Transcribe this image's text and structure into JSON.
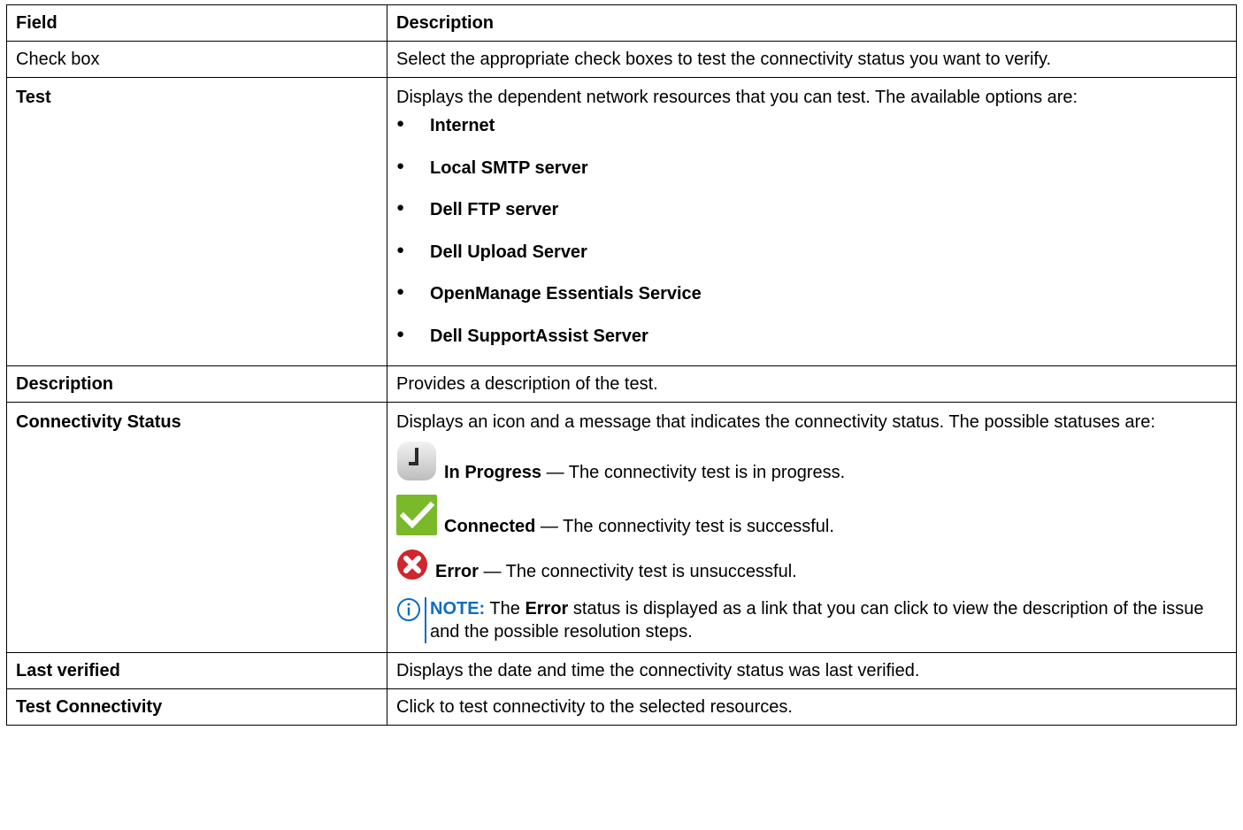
{
  "header": {
    "col1": "Field",
    "col2": "Description"
  },
  "rows": {
    "check_box": {
      "field": "Check box",
      "desc": "Select the appropriate check boxes to test the connectivity status you want to verify."
    },
    "test": {
      "field": "Test",
      "desc": "Displays the dependent network resources that you can test. The available options are:",
      "options": [
        "Internet",
        "Local SMTP server",
        "Dell FTP server",
        "Dell Upload Server",
        "OpenManage Essentials Service",
        "Dell SupportAssist Server"
      ]
    },
    "description": {
      "field": "Description",
      "desc": "Provides a description of the test."
    },
    "connectivity": {
      "field": "Connectivity Status",
      "desc": "Displays an icon and a message that indicates the connectivity status. The possible statuses are:",
      "statuses": [
        {
          "icon": "clock-icon",
          "name": "In Progress",
          "text": " — The connectivity test is in progress."
        },
        {
          "icon": "checkmark-icon",
          "name": "Connected",
          "text": " — The connectivity test is successful."
        },
        {
          "icon": "error-icon",
          "name": "Error",
          "text": " — The connectivity test is unsuccessful."
        }
      ],
      "note": {
        "label": "NOTE:",
        "pre": " The ",
        "strong": "Error",
        "post": " status is displayed as a link that you can click to view the description of the issue and the possible resolution steps."
      }
    },
    "last_verified": {
      "field": "Last verified",
      "desc": "Displays the date and time the connectivity status was last verified."
    },
    "test_connectivity": {
      "field": "Test Connectivity",
      "desc": "Click to test connectivity to the selected resources."
    }
  },
  "colors": {
    "note_blue": "#0e6dbd",
    "check_green": "#7ab929",
    "error_red": "#d0262e"
  }
}
